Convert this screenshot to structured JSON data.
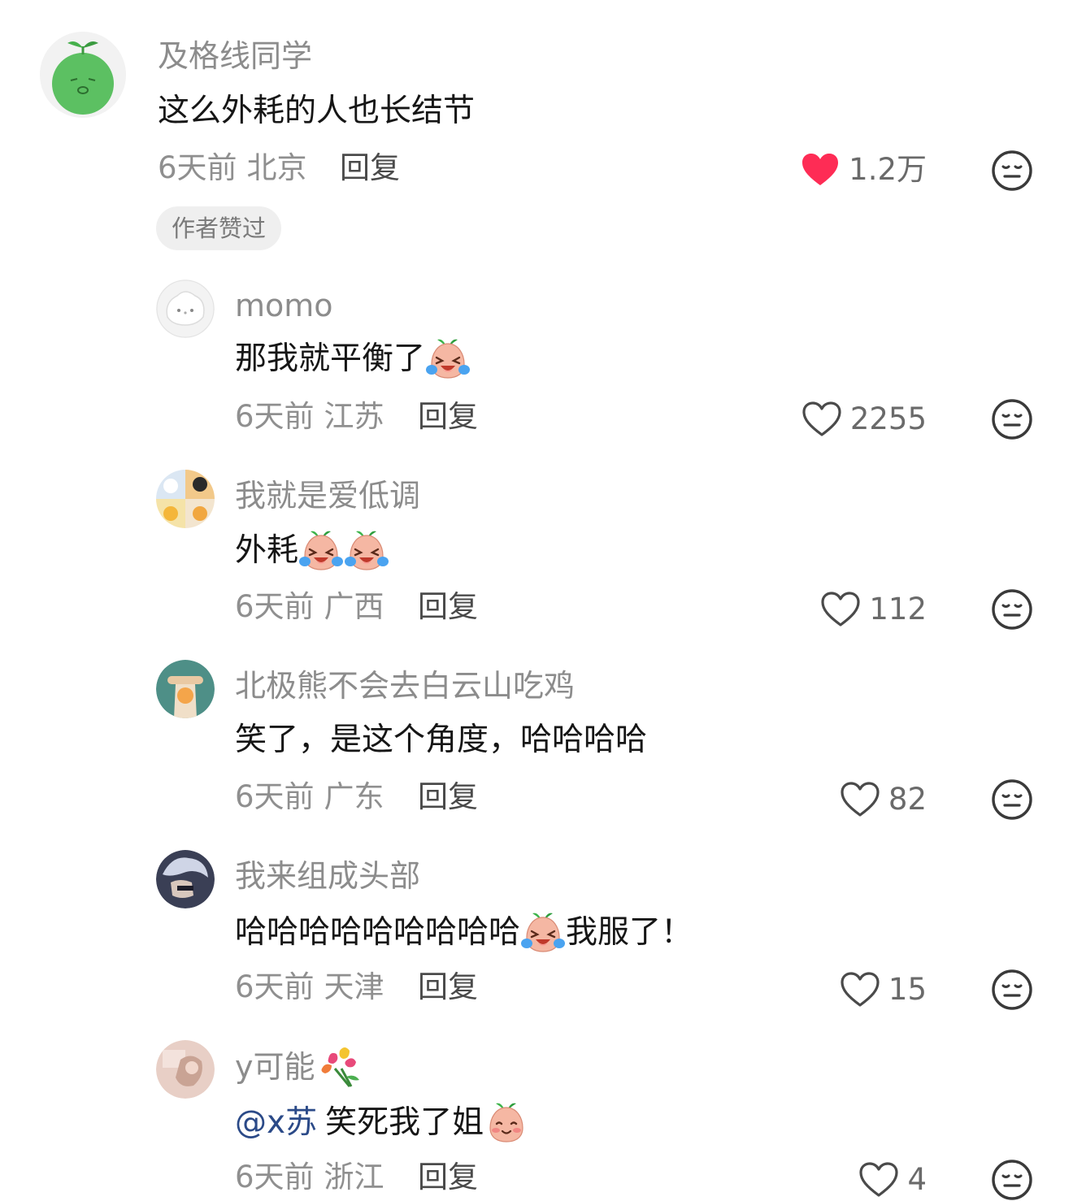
{
  "comments": [
    {
      "username": "及格线同学",
      "content": "这么外耗的人也长结节",
      "time": "6天前",
      "location": "北京",
      "reply": "回复",
      "likes": "1.2万",
      "liked": true,
      "author_badge": "作者赞过"
    },
    {
      "username": "momo",
      "content": "那我就平衡了",
      "time": "6天前",
      "location": "江苏",
      "reply": "回复",
      "likes": "2255"
    },
    {
      "username": "我就是爱低调",
      "content": "外耗",
      "time": "6天前",
      "location": "广西",
      "reply": "回复",
      "likes": "112"
    },
    {
      "username": "北极熊不会去白云山吃鸡",
      "content": "笑了，是这个角度，哈哈哈哈",
      "time": "6天前",
      "location": "广东",
      "reply": "回复",
      "likes": "82"
    },
    {
      "username": "我来组成头部",
      "content": "哈哈哈哈哈哈哈哈哈",
      "content_suffix": "我服了！",
      "time": "6天前",
      "location": "天津",
      "reply": "回复",
      "likes": "15"
    },
    {
      "username": "y可能",
      "mention": "@x苏",
      "content": "笑死我了姐",
      "time": "6天前",
      "location": "浙江",
      "reply": "回复",
      "likes": "4"
    }
  ],
  "colors": {
    "like_active": "#fe2c55",
    "meta": "#8f8f8f",
    "username": "#8c8c8c",
    "mention": "#2b4a88"
  }
}
